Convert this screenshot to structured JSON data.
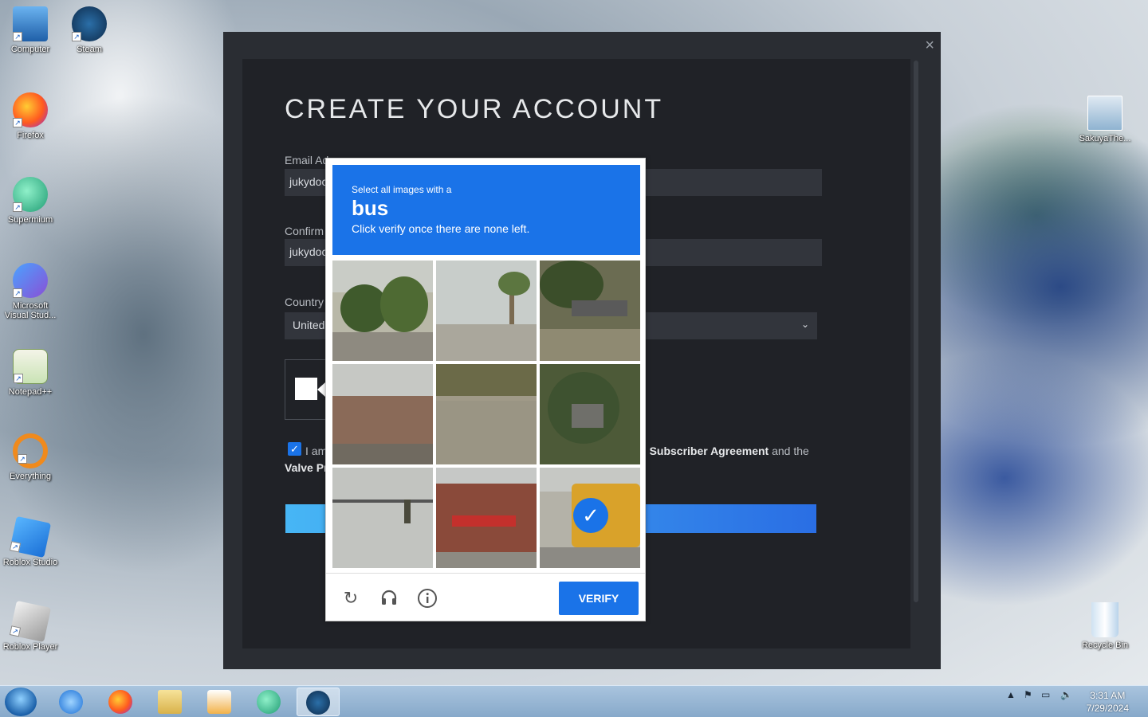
{
  "desktop": {
    "icons_left": [
      {
        "label": "Computer",
        "icon": "computer-icon"
      },
      {
        "label": "Steam",
        "icon": "steam-icon"
      },
      {
        "label": "Firefox",
        "icon": "firefox-icon"
      },
      {
        "label": "Supermium",
        "icon": "supermium-icon"
      },
      {
        "label": "Microsoft Visual Stud...",
        "icon": "visual-studio-icon"
      },
      {
        "label": "Notepad++",
        "icon": "notepadpp-icon"
      },
      {
        "label": "Everything",
        "icon": "everything-icon"
      },
      {
        "label": "Roblox Studio",
        "icon": "roblox-studio-icon"
      },
      {
        "label": "Roblox Player",
        "icon": "roblox-player-icon"
      }
    ],
    "icons_right": [
      {
        "label": "SakuyaThe...",
        "icon": "image-file-icon"
      },
      {
        "label": "Recycle Bin",
        "icon": "recycle-bin-icon"
      }
    ]
  },
  "steam": {
    "close": "×",
    "title": "CREATE YOUR ACCOUNT",
    "email_label": "Email Ad",
    "email_value": "jukydoc",
    "confirm_label": "Confirm",
    "confirm_value": "jukydoc",
    "country_label": "Country",
    "country_value": "United",
    "agree_prefix": "I am",
    "agree_link1": "Subscriber Agreement",
    "agree_mid": " and the",
    "agree_link2": "Valve Pr",
    "agree_left_fragment": ")"
  },
  "recaptcha": {
    "instruction": "Select all images with a",
    "target": "bus",
    "subtext": "Click verify once there are none left.",
    "verify": "VERIFY",
    "icons": [
      "reload-icon",
      "audio-icon",
      "info-icon"
    ],
    "selected_tile": 9
  },
  "taskbar": {
    "time": "3:31 AM",
    "date": "7/29/2024",
    "pinned": [
      "start-button",
      "internet-explorer-icon",
      "firefox-icon",
      "file-explorer-icon",
      "media-player-icon",
      "supermium-icon",
      "steam-icon"
    ]
  },
  "colors": {
    "recaptcha_blue": "#1a73e8",
    "steam_bg": "#202227",
    "continue_gradient_start": "#47b6f5",
    "continue_gradient_end": "#2a6ee4"
  }
}
